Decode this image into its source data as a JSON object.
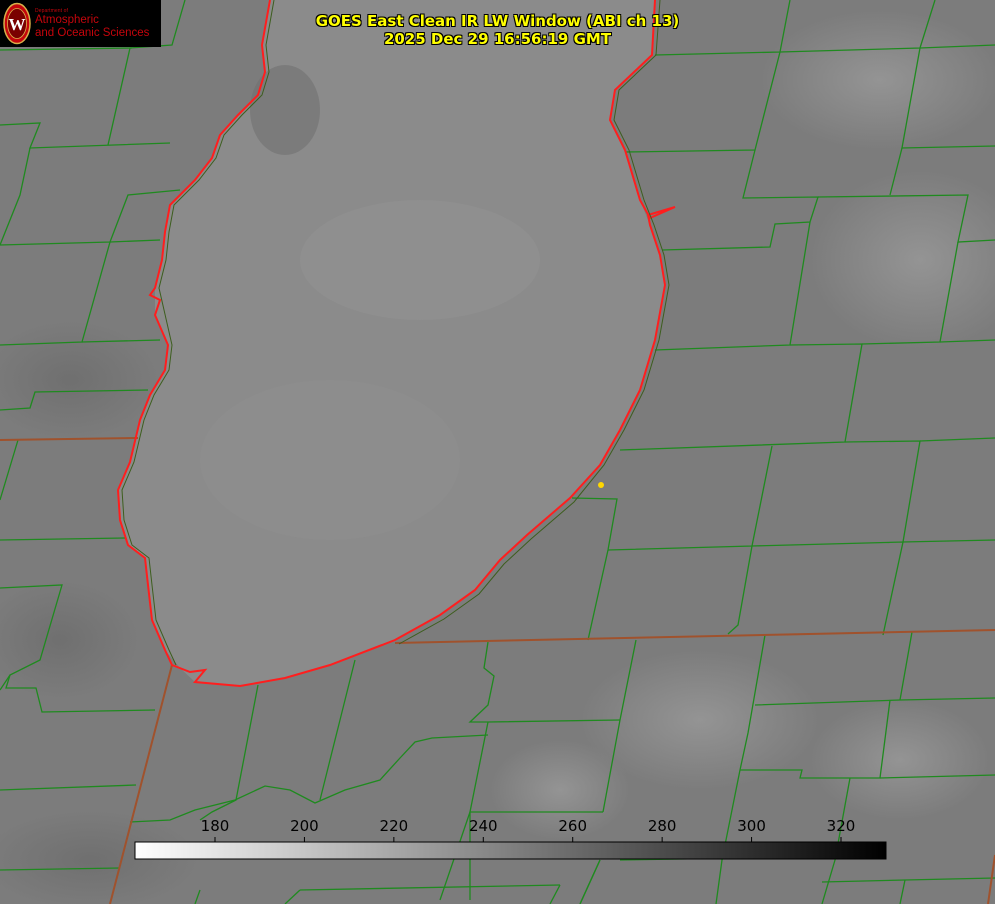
{
  "title": {
    "line1": "GOES East Clean IR LW Window (ABI ch 13)",
    "line2": "2025 Dec 29 16:56:19 GMT"
  },
  "logo": {
    "dept": "Department of",
    "line1": "Atmospheric",
    "line2": "and Oceanic Sciences",
    "seal_letter": "W"
  },
  "colorbar": {
    "ticks": [
      "180",
      "200",
      "220",
      "240",
      "260",
      "280",
      "300",
      "320"
    ],
    "colors": {
      "start": "#ffffff",
      "end": "#000000"
    }
  },
  "colors": {
    "background": "#7b7b7b",
    "lake": "#8c8c8c",
    "county_lines": "#1f8a1f",
    "state_lines": "#a0522d",
    "lake_shore": "#ff1e1e",
    "title_text": "#ffff00",
    "marker": "#ffd700",
    "brand": "#c5050c"
  }
}
